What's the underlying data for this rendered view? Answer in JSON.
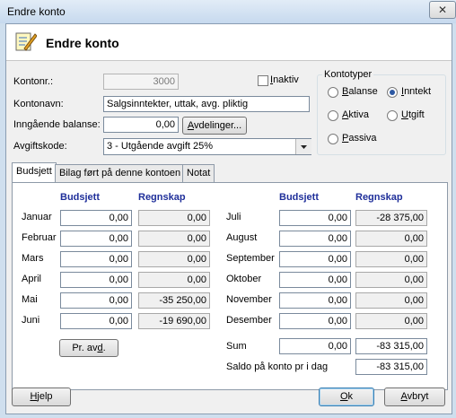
{
  "window": {
    "title": "Endre konto",
    "close_glyph": "✕"
  },
  "header": {
    "title": "Endre konto",
    "icon": "edit-document-icon"
  },
  "form": {
    "kontonr_label": "Kontonr.:",
    "kontonr_value": "3000",
    "inaktiv_label": "Inaktiv",
    "kontonavn_label": "Kontonavn:",
    "kontonavn_value": "Salgsinntekter, uttak, avg. pliktig",
    "inngaende_label": "Inngående balanse:",
    "inngaende_value": "0,00",
    "avdelinger_button": "Avdelinger...",
    "avgiftskode_label": "Avgiftskode:",
    "avgiftskode_value": "3 - Utgående avgift 25%"
  },
  "kontotyper": {
    "title": "Kontotyper",
    "options": [
      "Balanse",
      "Inntekt",
      "Aktiva",
      "Utgift",
      "Passiva"
    ],
    "selected": "Inntekt"
  },
  "tabs": [
    "Budsjett",
    "Bilag ført på denne kontoen",
    "Notat"
  ],
  "budget": {
    "budsjett_header": "Budsjett",
    "regnskap_header": "Regnskap",
    "left": [
      {
        "month": "Januar",
        "budsjett": "0,00",
        "regnskap": "0,00"
      },
      {
        "month": "Februar",
        "budsjett": "0,00",
        "regnskap": "0,00"
      },
      {
        "month": "Mars",
        "budsjett": "0,00",
        "regnskap": "0,00"
      },
      {
        "month": "April",
        "budsjett": "0,00",
        "regnskap": "0,00"
      },
      {
        "month": "Mai",
        "budsjett": "0,00",
        "regnskap": "-35 250,00"
      },
      {
        "month": "Juni",
        "budsjett": "0,00",
        "regnskap": "-19 690,00"
      }
    ],
    "right": [
      {
        "month": "Juli",
        "budsjett": "0,00",
        "regnskap": "-28 375,00"
      },
      {
        "month": "August",
        "budsjett": "0,00",
        "regnskap": "0,00"
      },
      {
        "month": "September",
        "budsjett": "0,00",
        "regnskap": "0,00"
      },
      {
        "month": "Oktober",
        "budsjett": "0,00",
        "regnskap": "0,00"
      },
      {
        "month": "November",
        "budsjett": "0,00",
        "regnskap": "0,00"
      },
      {
        "month": "Desember",
        "budsjett": "0,00",
        "regnskap": "0,00"
      }
    ],
    "pr_avd_button": "Pr. avd.",
    "sum_label": "Sum",
    "sum_budsjett": "0,00",
    "sum_regnskap": "-83 315,00",
    "saldo_label": "Saldo på konto pr i dag",
    "saldo_value": "-83 315,00"
  },
  "buttons": {
    "help": "Hjelp",
    "ok": "Ok",
    "cancel": "Avbryt"
  }
}
